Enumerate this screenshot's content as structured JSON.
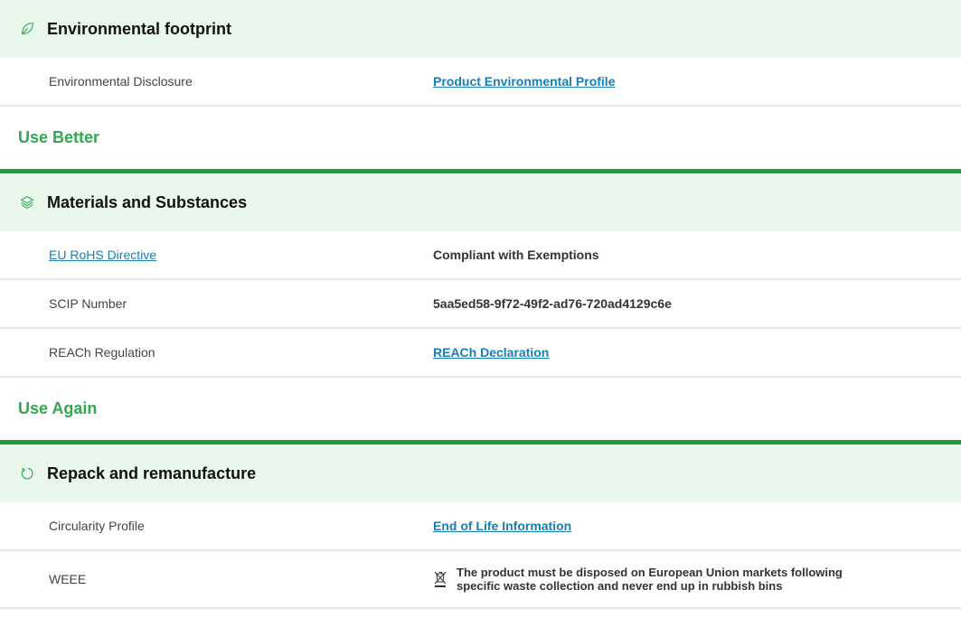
{
  "environmental_footprint": {
    "title": "Environmental footprint",
    "icon": "leaf-icon",
    "rows": [
      {
        "label": "Environmental Disclosure",
        "value": "Product Environmental Profile"
      }
    ]
  },
  "use_better": {
    "section_title": "Use Better",
    "materials": {
      "title": "Materials and Substances",
      "icon": "layers-icon",
      "rows": [
        {
          "label": "EU RoHS Directive",
          "value": "Compliant with Exemptions"
        },
        {
          "label": "SCIP Number",
          "value": "5aa5ed58-9f72-49f2-ad76-720ad4129c6e"
        },
        {
          "label": "REACh Regulation",
          "value": "REACh Declaration"
        }
      ]
    }
  },
  "use_again": {
    "section_title": "Use Again",
    "repack": {
      "title": "Repack and remanufacture",
      "icon": "refresh-icon",
      "rows": [
        {
          "label": "Circularity Profile",
          "value": "End of Life Information"
        },
        {
          "label": "WEEE",
          "value": "The product must be disposed on European Union markets following specific waste collection and never end up in rubbish bins",
          "icon": "crossed-bin-icon"
        }
      ]
    }
  },
  "colors": {
    "accent_green": "#1e9c3c",
    "header_bg": "#e9f7ec",
    "link_blue": "#1a7eb0"
  }
}
